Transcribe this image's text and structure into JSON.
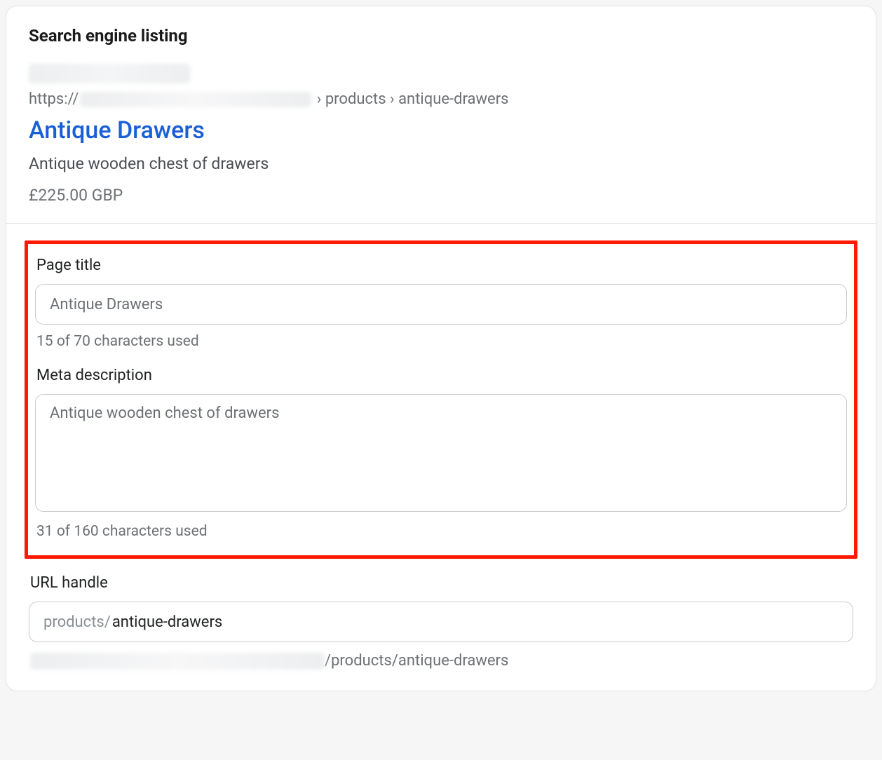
{
  "section_title": "Search engine listing",
  "preview": {
    "url_prefix": "https://",
    "url_suffix": " › products › antique-drawers",
    "title": "Antique Drawers",
    "description": "Antique wooden chest of drawers",
    "price": "£225.00 GBP"
  },
  "fields": {
    "page_title": {
      "label": "Page title",
      "value": "Antique Drawers",
      "helper": "15 of 70 characters used"
    },
    "meta_description": {
      "label": "Meta description",
      "value": "Antique wooden chest of drawers",
      "helper": "31 of 160 characters used"
    },
    "url_handle": {
      "label": "URL handle",
      "prefix": "products/",
      "value": "antique-drawers",
      "full_path": "/products/antique-drawers"
    }
  }
}
